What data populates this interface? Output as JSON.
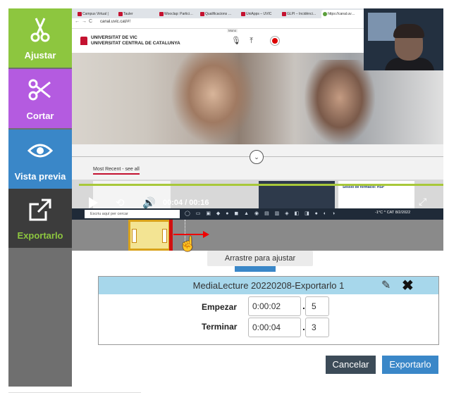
{
  "sidebar": {
    "items": [
      {
        "label": "Ajustar",
        "icon": "scissors-icon"
      },
      {
        "label": "Cortar",
        "icon": "cut-icon"
      },
      {
        "label": "Vista previa",
        "icon": "eye-icon"
      },
      {
        "label": "Exportarlo",
        "icon": "export-icon"
      }
    ]
  },
  "browser": {
    "tabs": [
      "Campus Virtual |",
      "Tauler",
      "Wooclap: Partici…",
      "Qualificacions …",
      "UniApps – UVIC",
      "GLPI – Incidènci…",
      "https://canal.uv…"
    ],
    "address": "canal.uvic.cat/#!",
    "site_name_line1": "UNIVERSITAT DE VIC",
    "site_name_line2": "UNIVERSITAT CENTRAL DE CATALUNYA",
    "mono_tooltip": "Mono",
    "most_recent": "Most Recent - see all",
    "thumb_title": "Sessió de formació: HSP",
    "taskbar_search": "Escriu aquí per cercar",
    "tray_text": "-1°C  ^  CAT  8/2/2022"
  },
  "player": {
    "time": "00:04 / 00:16",
    "progress_fraction": 0.25
  },
  "timeline": {
    "drag_hint": "Arrastre para ajustar"
  },
  "dialog": {
    "title": "MediaLecture 20220208-Exportarlo 1",
    "start_label": "Empezar",
    "start_time": "0:00:02",
    "start_frac": "5",
    "end_label": "Terminar",
    "end_time": "0:00:04",
    "end_frac": "3"
  },
  "actions": {
    "cancel": "Cancelar",
    "export": "Exportarlo"
  },
  "colors": {
    "adjust": "#8dc63f",
    "cut": "#b45be0",
    "preview": "#3a87c8",
    "export_bg": "#3c3c3c",
    "dialog_header": "#a7d7eb",
    "cancel_button": "#3c4b58",
    "export_button": "#3a87c8"
  }
}
